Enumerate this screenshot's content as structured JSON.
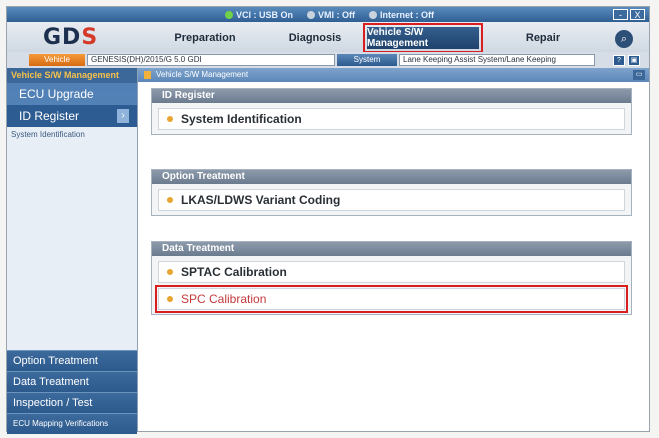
{
  "status": {
    "vci": "VCI : USB On",
    "vmi": "VMI : Off",
    "internet": "Internet : Off"
  },
  "window_buttons": [
    "-",
    "X"
  ],
  "logo": {
    "text": "GD",
    "accent": "S"
  },
  "tabs": [
    {
      "label": "Preparation"
    },
    {
      "label": "Diagnosis"
    },
    {
      "label": "Vehicle S/W Management",
      "active": true
    },
    {
      "label": "Repair"
    }
  ],
  "vehicle": {
    "button": "Vehicle",
    "value": "GENESIS(DH)/2015/G 5.0 GDI",
    "system_button": "System",
    "system_value": "Lane Keeping Assist System/Lane Keeping"
  },
  "sidebar": {
    "header": "Vehicle S/W Management",
    "items": [
      {
        "label": "ECU Upgrade"
      },
      {
        "label": "ID Register",
        "selected": true
      }
    ],
    "sub_item": "System Identification",
    "bottom": [
      "Option Treatment",
      "Data Treatment",
      "Inspection / Test",
      "ECU Mapping Verifications"
    ]
  },
  "main": {
    "breadcrumb": "Vehicle S/W Management",
    "sections": [
      {
        "title": "ID Register",
        "items": [
          "System Identification"
        ]
      },
      {
        "title": "Option Treatment",
        "items": [
          "LKAS/LDWS Variant Coding"
        ]
      },
      {
        "title": "Data Treatment",
        "items": [
          "SPTAC Calibration",
          "SPC Calibration"
        ]
      }
    ]
  },
  "colors": {
    "highlight": "#d81e1e",
    "sidebar": "#4f7fb4",
    "accent_orange": "#e8a531"
  }
}
